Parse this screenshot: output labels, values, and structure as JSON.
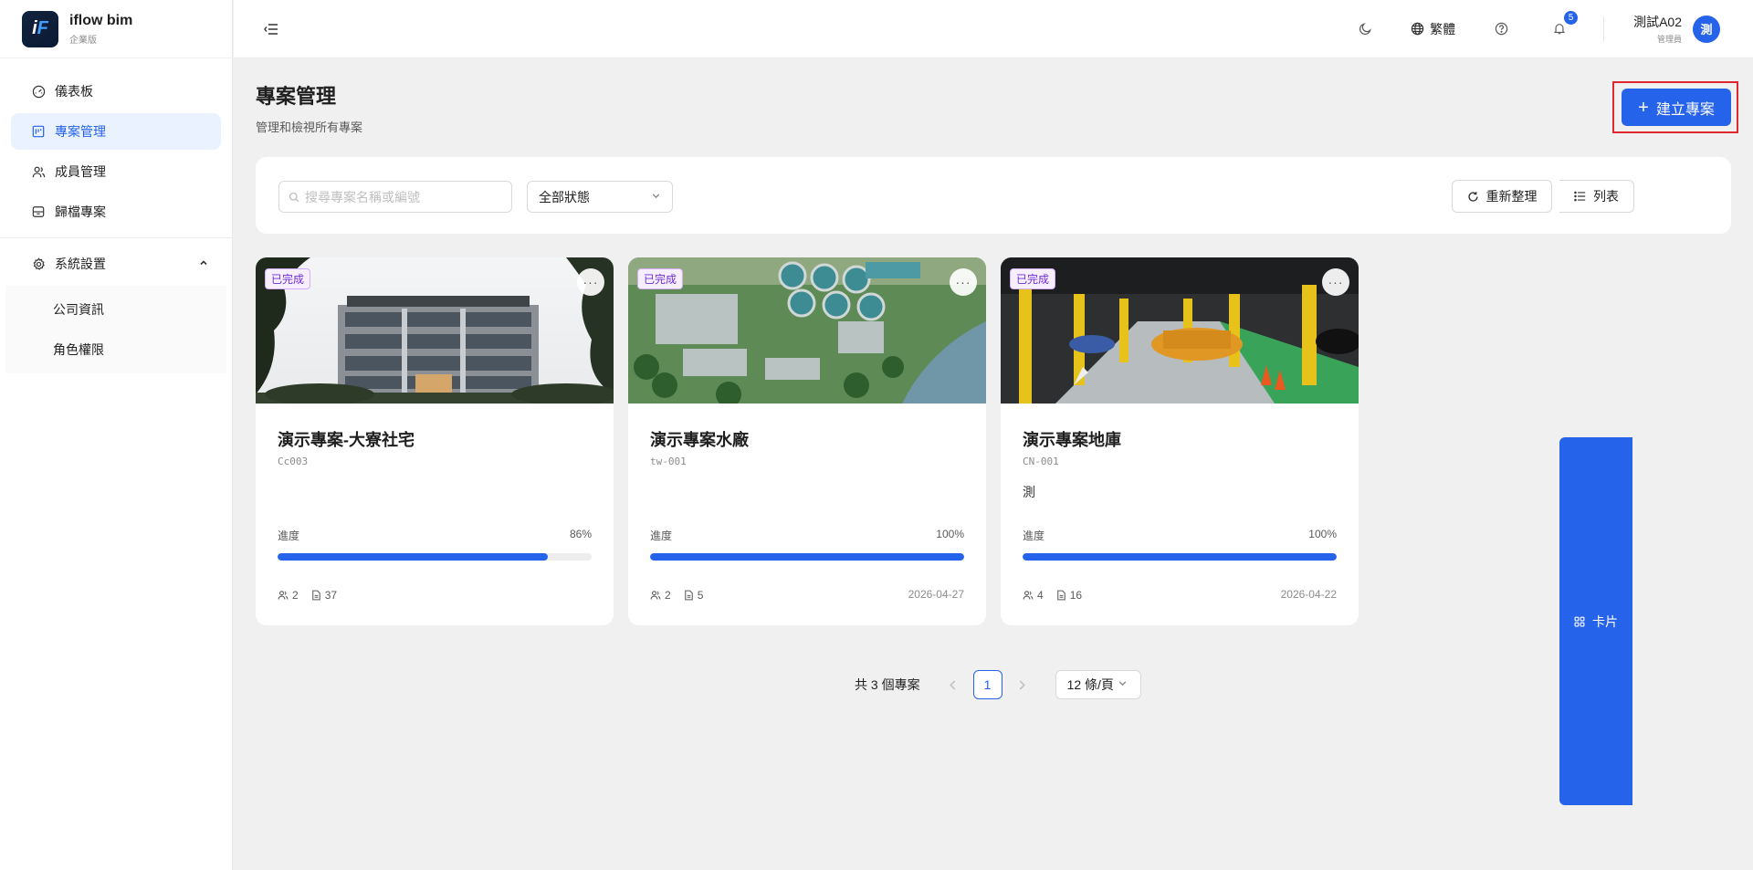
{
  "brand": {
    "name": "iflow bim",
    "edition": "企業版",
    "logo_text": "iF"
  },
  "sidebar": {
    "items": [
      {
        "label": "儀表板",
        "icon": "dashboard-icon"
      },
      {
        "label": "專案管理",
        "icon": "project-icon",
        "active": true
      },
      {
        "label": "成員管理",
        "icon": "members-icon"
      },
      {
        "label": "歸檔專案",
        "icon": "archive-icon"
      }
    ],
    "settings": {
      "label": "系統設置",
      "icon": "gear-icon",
      "expand_icon": "chevron-up-icon"
    },
    "sub_items": [
      {
        "label": "公司資訊"
      },
      {
        "label": "角色權限"
      }
    ]
  },
  "header": {
    "language": "繁體",
    "notification_count": "5",
    "user": {
      "name": "測試A02",
      "role": "管理員",
      "avatar_text": "測"
    }
  },
  "page": {
    "title": "專案管理",
    "description": "管理和檢視所有專案",
    "create_button": "建立專案"
  },
  "toolbar": {
    "search_placeholder": "搜尋專案名稱或編號",
    "status_filter": "全部狀態",
    "refresh_label": "重新整理",
    "card_view_label": "卡片",
    "list_view_label": "列表"
  },
  "projects": [
    {
      "title": "演示專案-大寮社宅",
      "code": "Cc003",
      "description": "",
      "status": "已完成",
      "progress_label": "進度",
      "progress_text": "86%",
      "progress": 86,
      "members": "2",
      "files": "37",
      "date": ""
    },
    {
      "title": "演示專案水廠",
      "code": "tw-001",
      "description": "",
      "status": "已完成",
      "progress_label": "進度",
      "progress_text": "100%",
      "progress": 100,
      "members": "2",
      "files": "5",
      "date": "2026-04-27"
    },
    {
      "title": "演示專案地庫",
      "code": "CN-001",
      "description": "測",
      "status": "已完成",
      "progress_label": "進度",
      "progress_text": "100%",
      "progress": 100,
      "members": "4",
      "files": "16",
      "date": "2026-04-22"
    }
  ],
  "pagination": {
    "total_text": "共 3 個專案",
    "current_page": "1",
    "page_size": "12 條/頁"
  },
  "colors": {
    "primary": "#2563eb",
    "highlight_border": "#e0262e",
    "status_tag": "#722ed1"
  }
}
